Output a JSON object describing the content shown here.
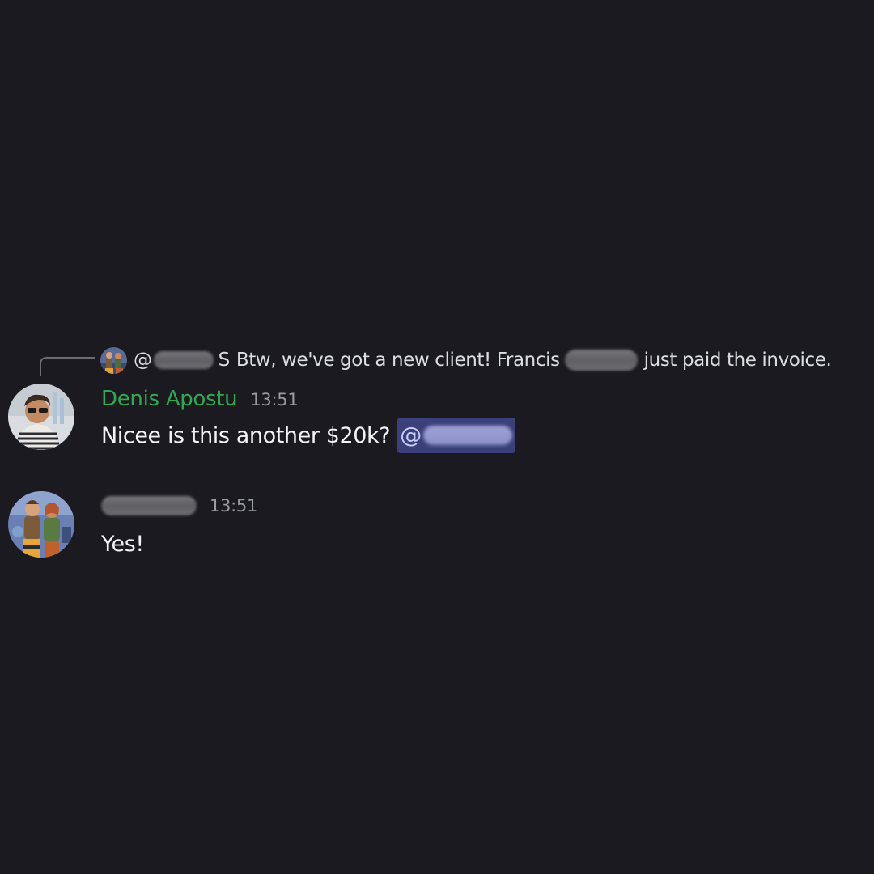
{
  "reply": {
    "at_symbol": "@",
    "name_suffix": "S",
    "text_before": "Btw, we've got a new client! Francis",
    "text_after": "just paid the invoice."
  },
  "messages": [
    {
      "username": "Denis Apostu",
      "timestamp": "13:51",
      "text": "Nicee is this another $20k?",
      "mention_at": "@",
      "username_color": "#2fa84f"
    },
    {
      "username": "",
      "timestamp": "13:51",
      "text": "Yes!"
    }
  ],
  "colors": {
    "background": "#1b1a20",
    "mention_bg": "#3b3f7a",
    "mention_text": "#c9cdfb"
  }
}
